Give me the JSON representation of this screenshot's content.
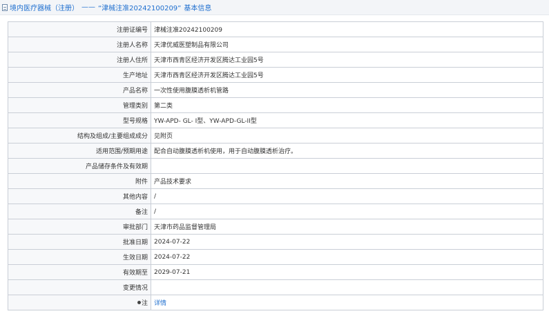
{
  "header": {
    "category": "境内医疗器械（注册）",
    "separator": "——",
    "record_title": "“津械注准20242100209”",
    "section_title": "基本信息"
  },
  "rows": [
    {
      "label": "注册证编号",
      "value": "津械注准20242100209"
    },
    {
      "label": "注册人名称",
      "value": "天津优威医塑制品有限公司"
    },
    {
      "label": "注册人住所",
      "value": "天津市西青区经济开发区腾达工业园5号"
    },
    {
      "label": "生产地址",
      "value": "天津市西青区经济开发区腾达工业园5号"
    },
    {
      "label": "产品名称",
      "value": "一次性使用腹膜透析机管路"
    },
    {
      "label": "管理类别",
      "value": "第二类"
    },
    {
      "label": "型号规格",
      "value": "YW-APD- GL- I型、YW-APD-GL-II型"
    },
    {
      "label": "结构及组成/主要组成成分",
      "value": "见附页"
    },
    {
      "label": "适用范围/预期用途",
      "value": "配合自动腹膜透析机使用，用于自动腹膜透析治疗。"
    },
    {
      "label": "产品储存条件及有效期",
      "value": ""
    },
    {
      "label": "附件",
      "value": "产品技术要求"
    },
    {
      "label": "其他内容",
      "value": "/"
    },
    {
      "label": "备注",
      "value": "/"
    },
    {
      "label": "审批部门",
      "value": "天津市药品监督管理局"
    },
    {
      "label": "批准日期",
      "value": "2024-07-22"
    },
    {
      "label": "生效日期",
      "value": "2024-07-22"
    },
    {
      "label": "有效期至",
      "value": "2029-07-21"
    },
    {
      "label": "变更情况",
      "value": ""
    }
  ],
  "note_row": {
    "label": "注",
    "link": "详情"
  }
}
